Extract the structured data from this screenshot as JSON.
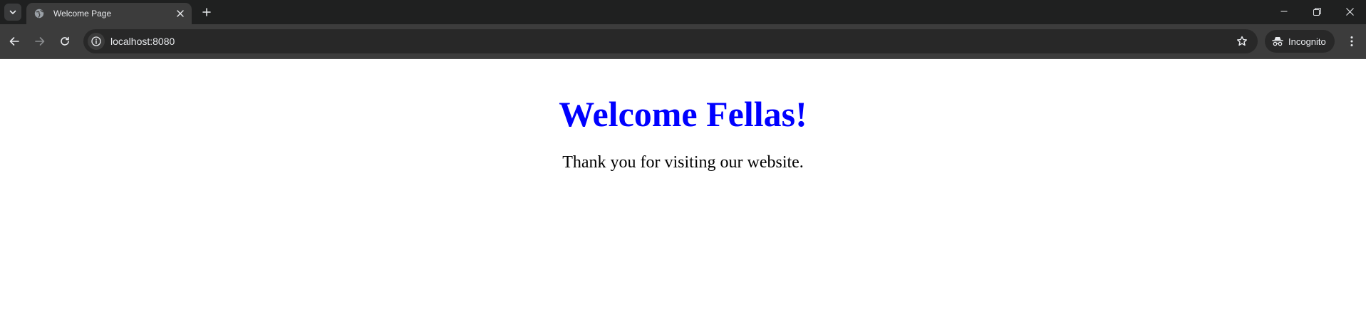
{
  "browser": {
    "tab": {
      "title": "Welcome Page",
      "favicon": "globe-icon"
    },
    "address_bar": {
      "url": "localhost:8080"
    },
    "profile": {
      "label": "Incognito"
    }
  },
  "page": {
    "heading": "Welcome Fellas!",
    "paragraph": "Thank you for visiting our website.",
    "heading_color": "#0000ff",
    "text_color": "#000000"
  }
}
